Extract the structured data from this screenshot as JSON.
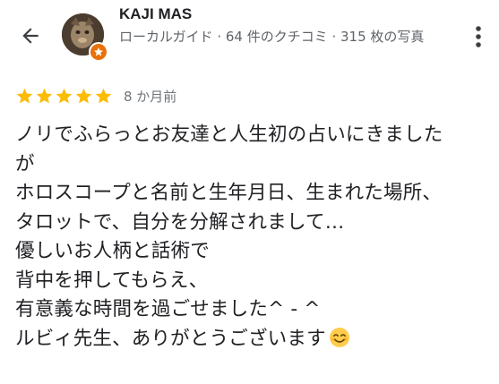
{
  "header": {
    "back_icon": "arrow-back-icon",
    "author_name": "KAJI MAS",
    "author_meta": "ローカルガイド · 64 件のクチコミ · 315 枚の写真",
    "badge_icon": "local-guide-star-icon",
    "more_icon": "more-vertical-icon"
  },
  "rating": {
    "stars": 5,
    "max_stars": 5,
    "star_color": "#fbbc04",
    "time_ago": "8 か月前"
  },
  "review": {
    "lines": [
      "ノリでふらっとお友達と人生初の占いにきました",
      "が",
      "ホロスコープと名前と生年月日、生まれた場所、",
      "タロットで、自分を分解されまして…",
      "優しいお人柄と話術で",
      "背中を押してもらえ、",
      "有意義な時間を過ごせました^ - ^",
      "ルビィ先生、ありがとうございます"
    ],
    "trailing_emoji": "smiling-face-icon"
  }
}
